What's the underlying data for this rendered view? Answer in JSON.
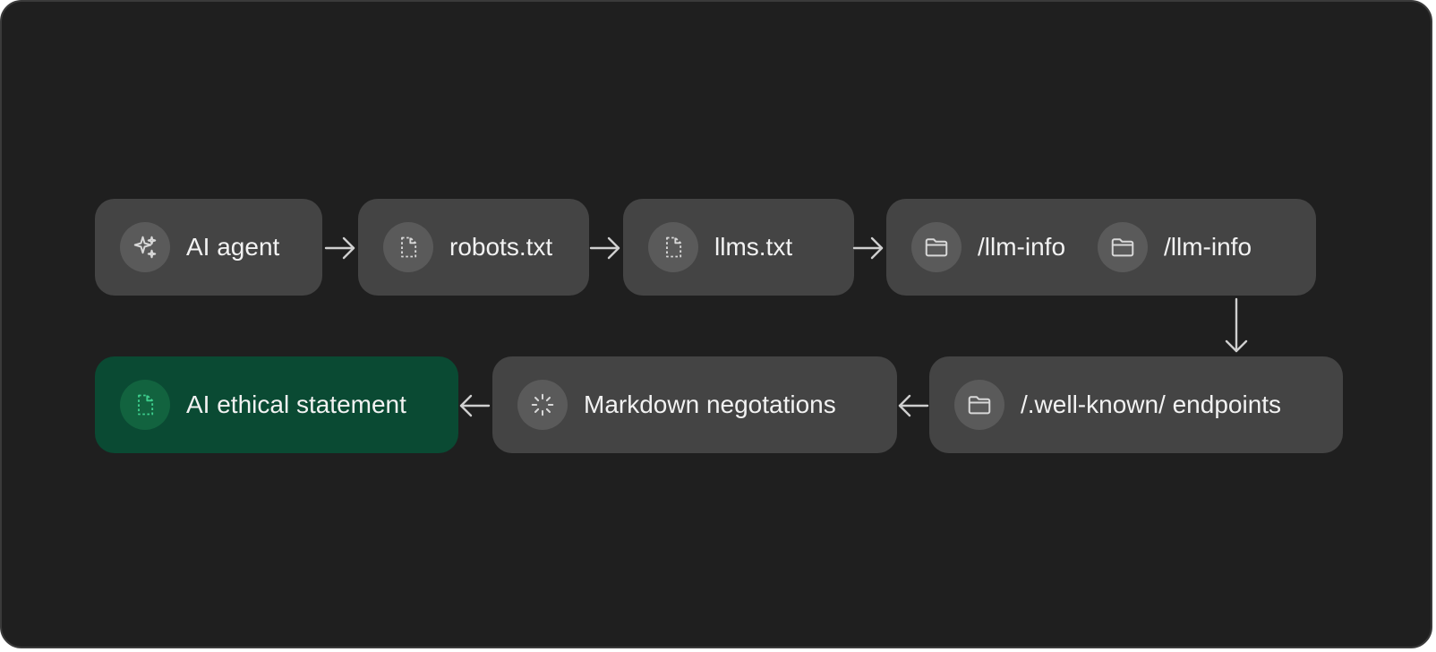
{
  "diagram": {
    "nodes": [
      {
        "id": "ai-agent",
        "icon": "sparkles-icon",
        "labels": [
          "AI agent"
        ]
      },
      {
        "id": "robots",
        "icon": "file-icon",
        "labels": [
          "robots.txt"
        ]
      },
      {
        "id": "llms",
        "icon": "file-icon",
        "labels": [
          "llms.txt"
        ]
      },
      {
        "id": "llm-info",
        "icon": "folder-icon",
        "labels": [
          "/llm-info",
          "/llm-info"
        ]
      },
      {
        "id": "well-known",
        "icon": "folder-icon",
        "labels": [
          "/.well-known/ endpoints"
        ]
      },
      {
        "id": "markdown",
        "icon": "loader-icon",
        "labels": [
          "Markdown negotations"
        ]
      },
      {
        "id": "ethical",
        "icon": "file-icon",
        "labels": [
          "AI ethical statement"
        ]
      }
    ],
    "highlight_color": "#0a4a33",
    "highlight_icon_color": "#3ecf8e",
    "node_color": "#444444",
    "background_color": "#1f1f1f"
  }
}
